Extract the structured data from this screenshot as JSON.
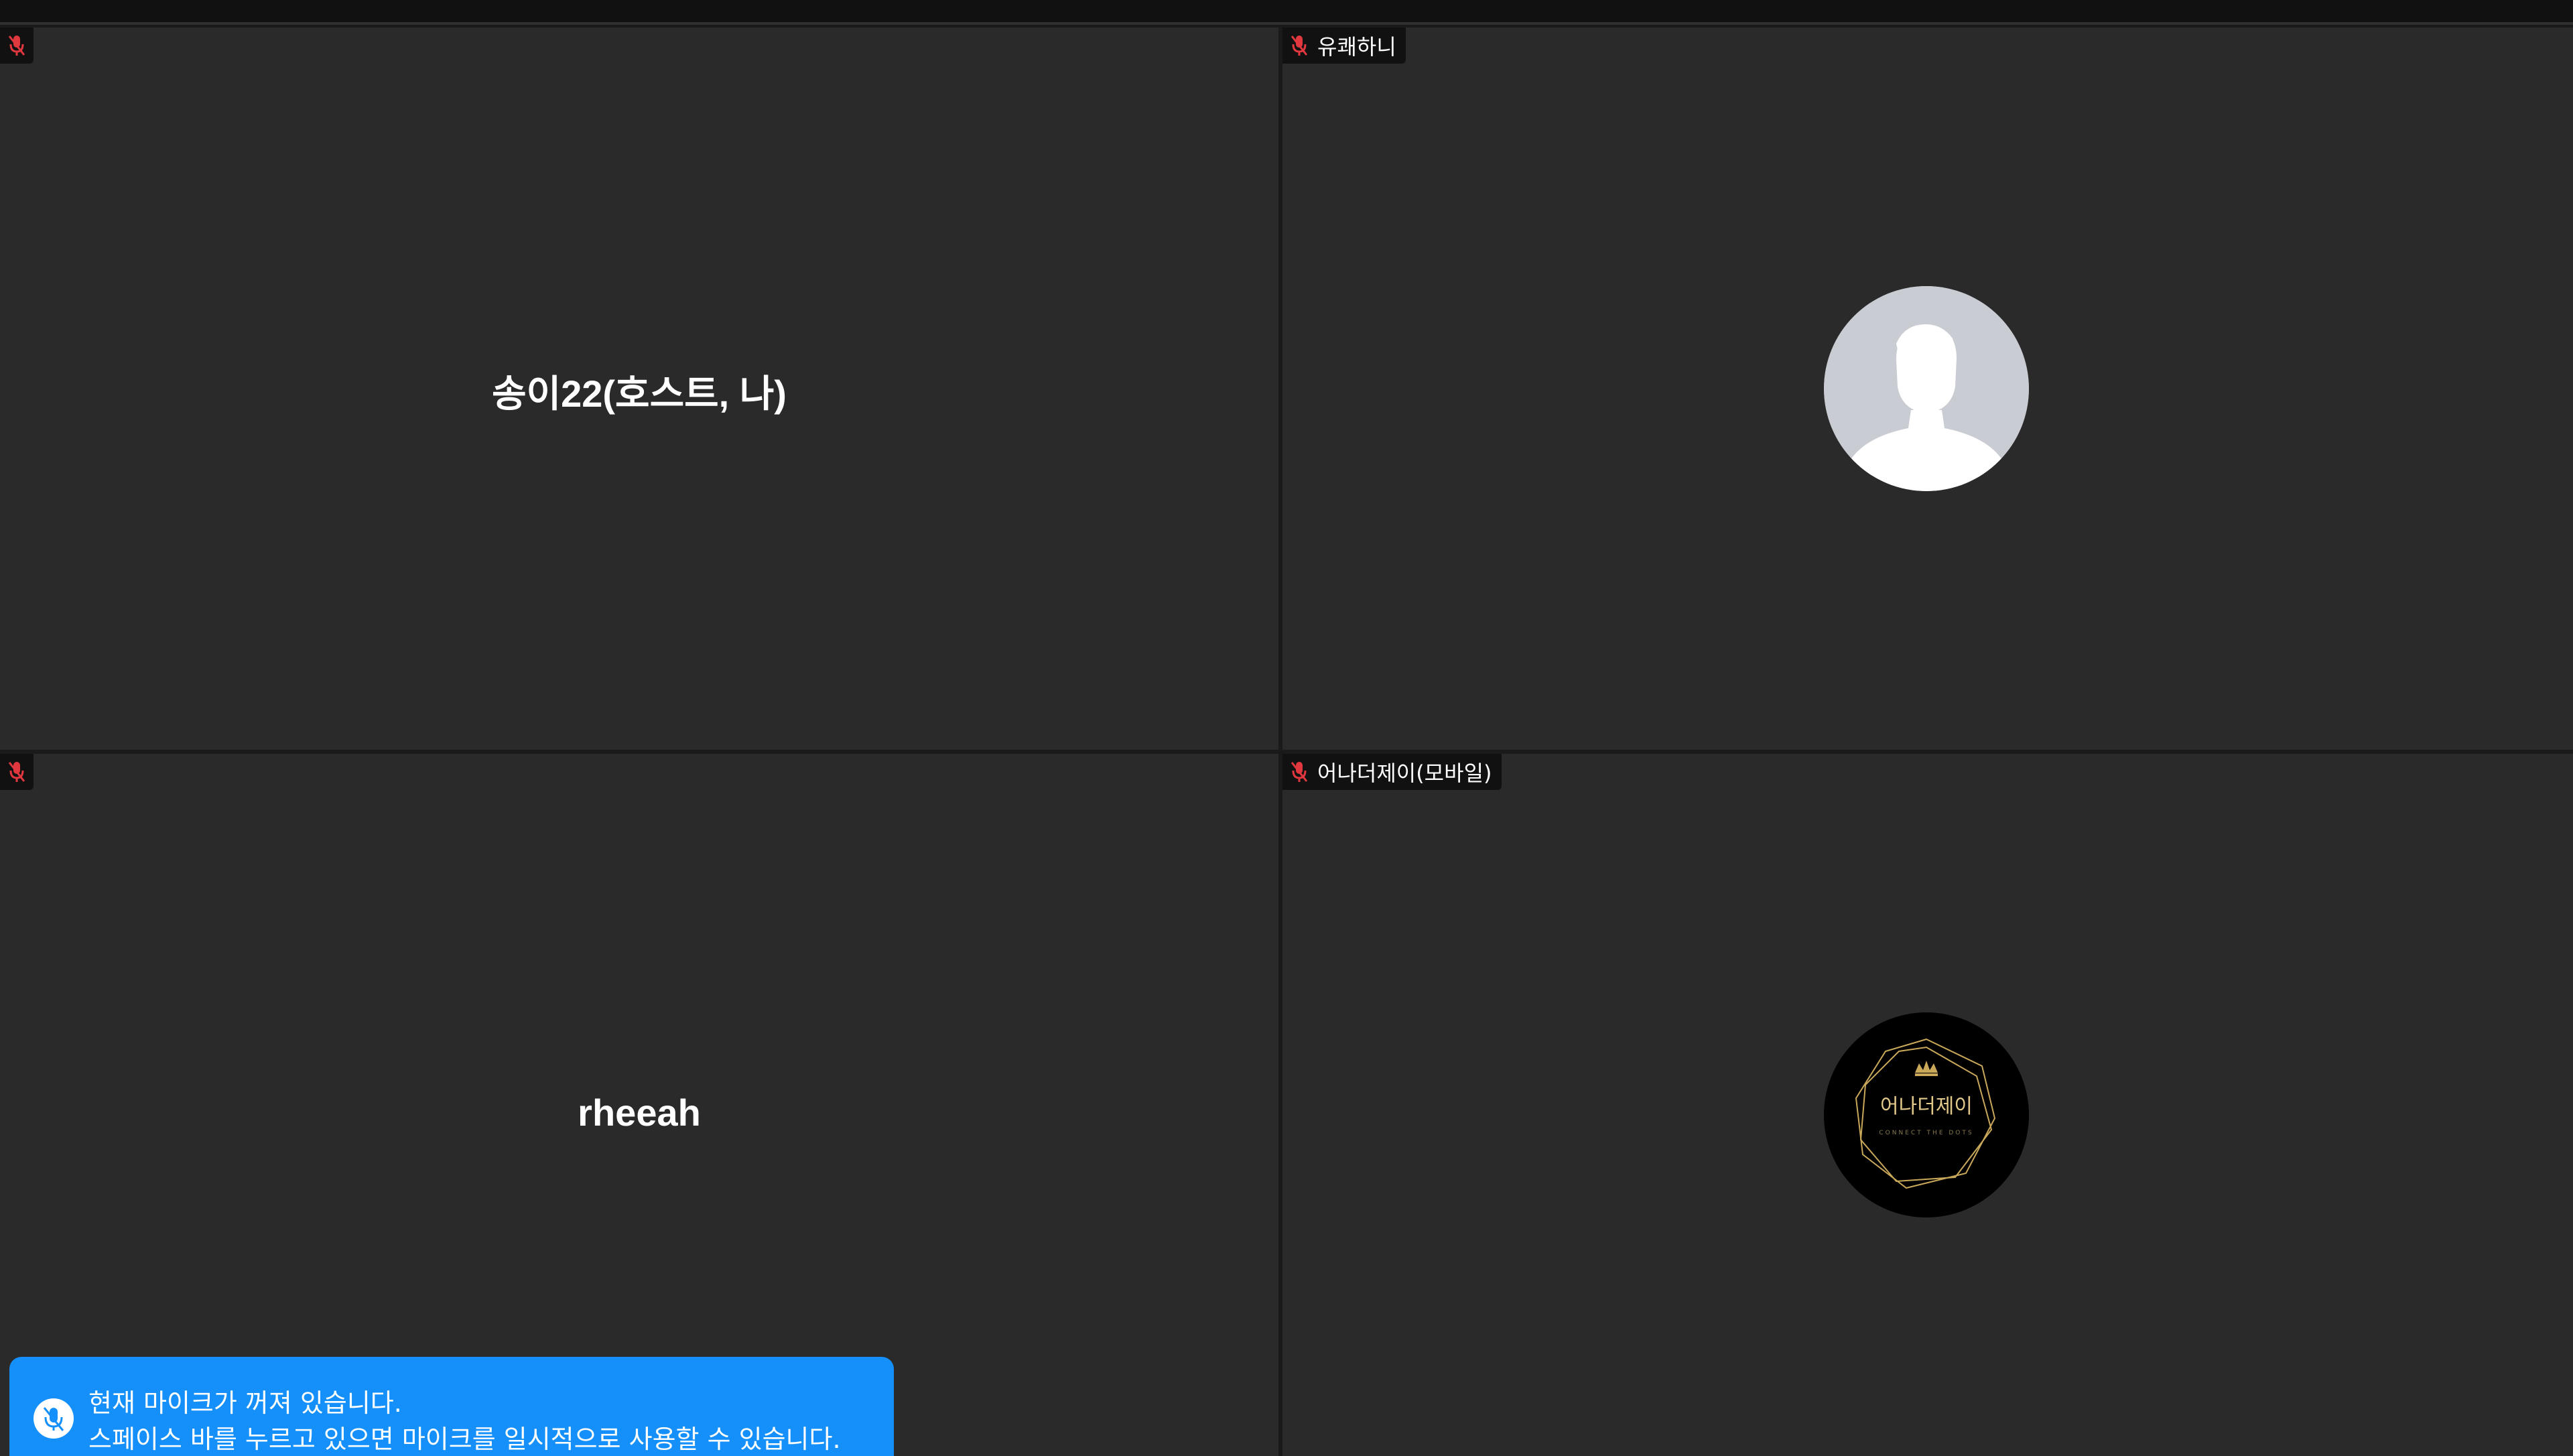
{
  "tiles": [
    {
      "name_tag": "",
      "center_text": "송이22(호스트, 나)",
      "muted": true
    },
    {
      "name_tag": "유쾌하니",
      "avatar": "default-person-icon",
      "muted": true
    },
    {
      "name_tag": "",
      "center_text": "rheeah",
      "muted": true
    },
    {
      "name_tag": "어나더제이(모바일)",
      "avatar": "profile-logo",
      "muted": true,
      "logo": {
        "title": "어나더제이",
        "subtitle": "CONNECT THE DOTS"
      }
    }
  ],
  "toast": {
    "line1": "현재 마이크가 꺼져 있습니다.",
    "line2": "스페이스 바를 누르고 있으면 마이크를 일시적으로 사용할 수 있습니다.",
    "icon": "mic-off-icon"
  },
  "colors": {
    "tile_bg": "#2a2a2a",
    "toast_bg": "#1590fb",
    "muted_mic": "#e0383e",
    "logo_gold": "#c9a85a"
  }
}
